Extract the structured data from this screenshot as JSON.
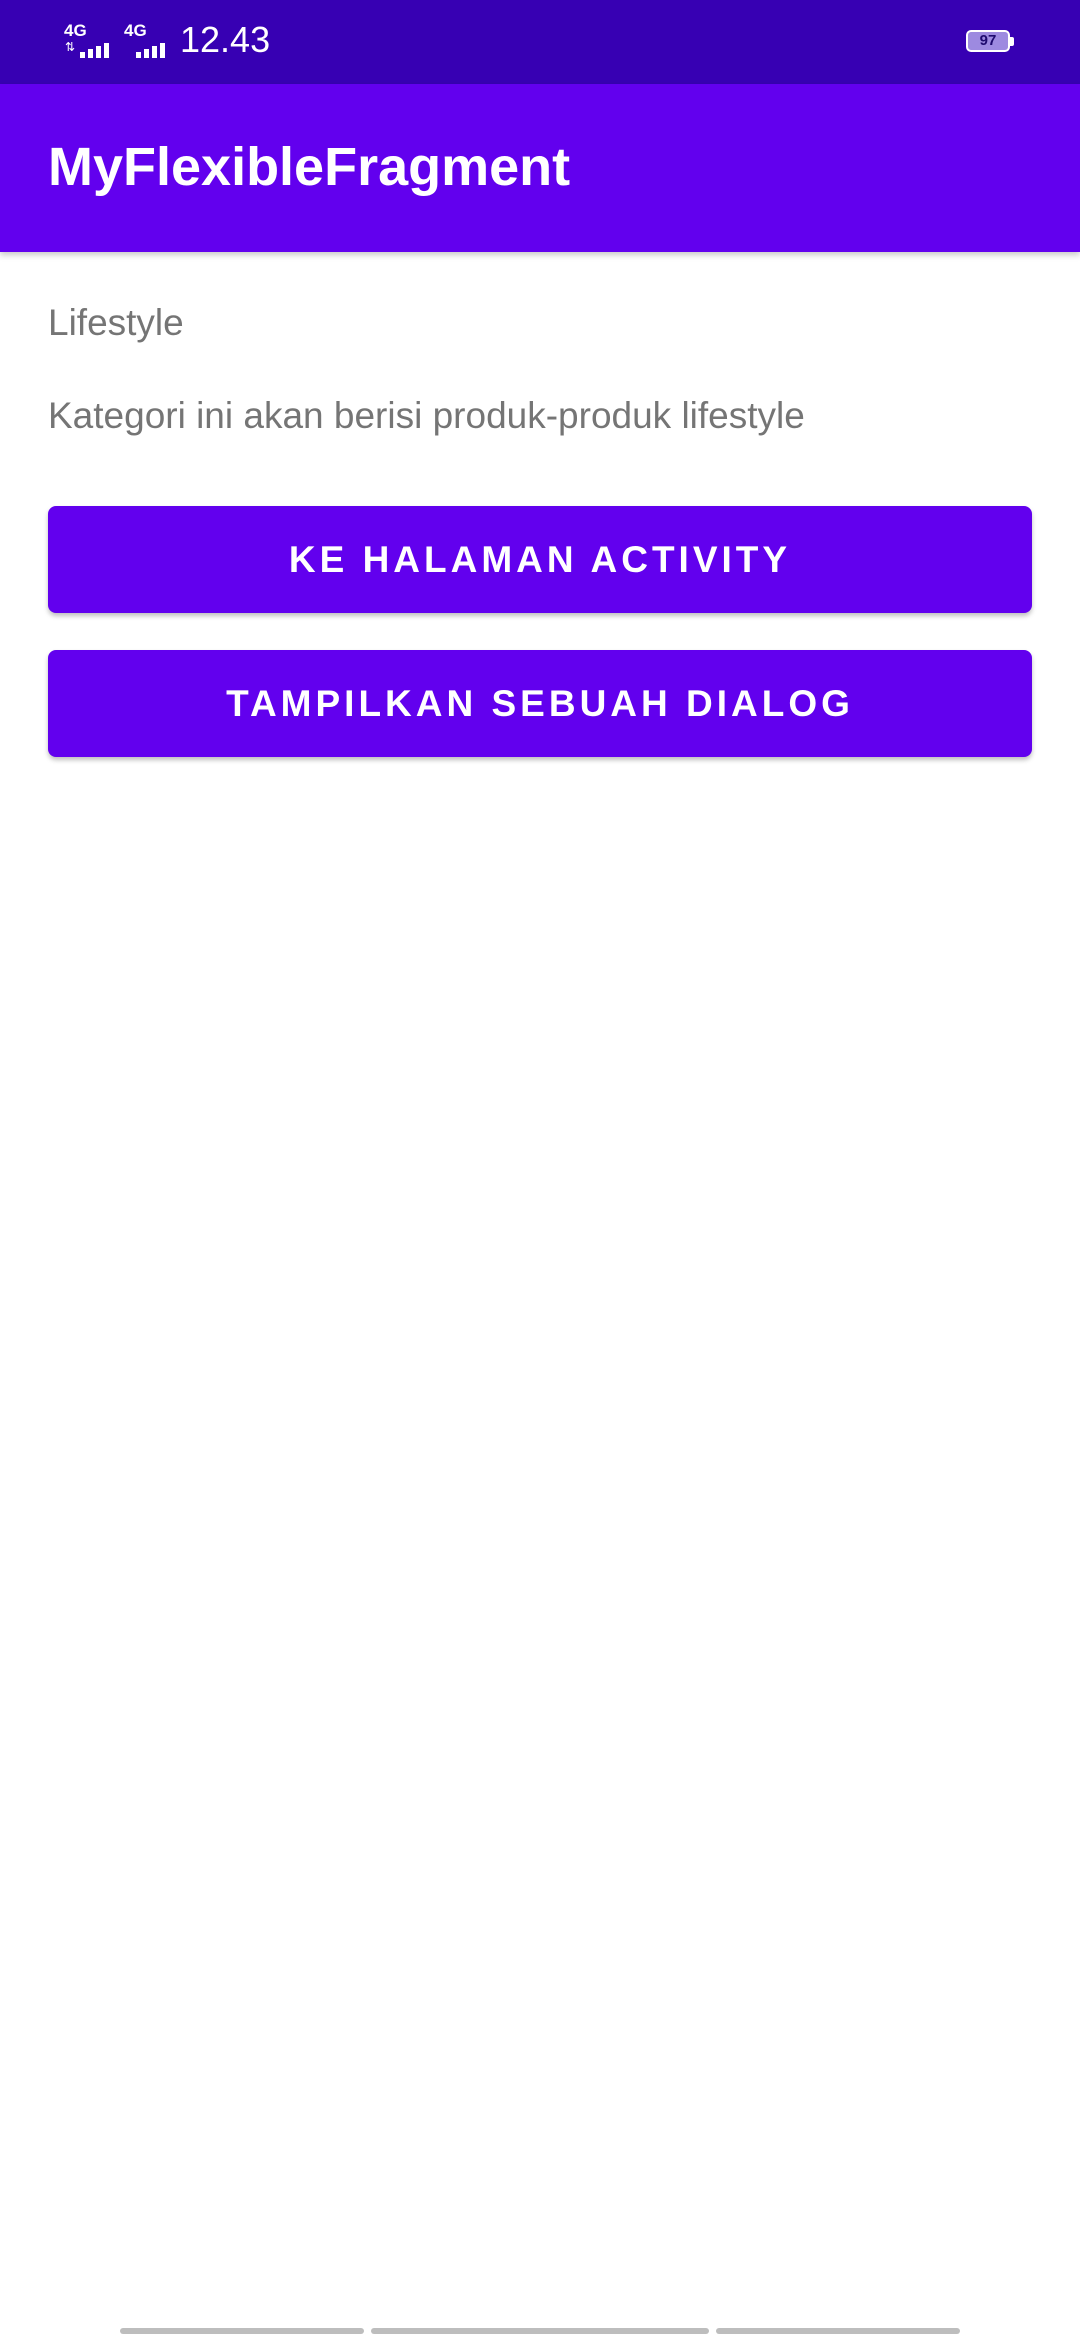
{
  "status_bar": {
    "network_1": "4G",
    "network_2": "4G",
    "time": "12.43",
    "battery_level": "97",
    "background_color": "#3700b3",
    "icons": [
      "signal-icon",
      "signal-icon",
      "battery-icon"
    ]
  },
  "app_bar": {
    "title": "MyFlexibleFragment",
    "background_color": "#6200ee"
  },
  "content": {
    "category_title": "Lifestyle",
    "category_description": "Kategori ini akan berisi produk-produk lifestyle",
    "text_color": "#757575"
  },
  "buttons": {
    "to_activity_label": "KE HALAMAN ACTIVITY",
    "show_dialog_label": "TAMPILKAN SEBUAH DIALOG",
    "background_color": "#6200ee"
  }
}
